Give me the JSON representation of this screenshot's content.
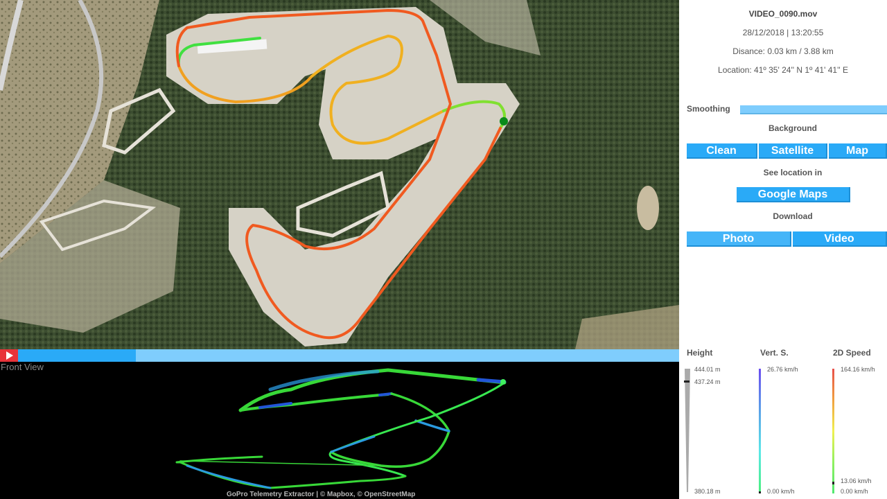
{
  "video": {
    "filename": "VIDEO_0090.mov",
    "datetime": "28/12/2018 | 13:20:55",
    "distance": "Disance: 0.03 km / 3.88 km",
    "location": "Location: 41º 35' 24'' N 1º 41' 41'' E"
  },
  "controls": {
    "smoothing_label": "Smoothing",
    "background_label": "Background",
    "background_options": [
      "Clean",
      "Satellite",
      "Map"
    ],
    "see_location_label": "See location in",
    "google_maps_button": "Google Maps",
    "download_label": "Download",
    "download_options": [
      "Photo",
      "Video"
    ]
  },
  "timeline": {
    "progress": 0.2,
    "play_icon": "play-icon"
  },
  "front_view": {
    "label": "Front View",
    "credits": "GoPro Telemetry Extractor | © Mapbox, © OpenStreetMap"
  },
  "gauges": {
    "height": {
      "title": "Height",
      "max": "444.01 m",
      "current": "437.24 m",
      "min": "380.18 m",
      "current_fraction": 0.9,
      "color": "#aaaaaa"
    },
    "vert_speed": {
      "title": "Vert. S.",
      "max": "26.76 km/h",
      "min": "0.00 km/h",
      "current_fraction": 0.0,
      "colors": [
        "#6a4cf0",
        "#5aa0e8",
        "#5ae8e8",
        "#4af07a"
      ]
    },
    "speed_2d": {
      "title": "2D Speed",
      "max": "164.16 km/h",
      "current": "13.06 km/h",
      "min": "0.00 km/h",
      "current_fraction": 0.08,
      "colors": [
        "#e8504a",
        "#f0a040",
        "#f0f050",
        "#90f060",
        "#50e870"
      ]
    },
    "marker_color": "#222222"
  },
  "map": {
    "background": "satellite",
    "current_position_color": "#0a8a1a",
    "track_gradient": [
      "#40e040",
      "#c8f020",
      "#f0e020",
      "#f0a020",
      "#f05020"
    ]
  }
}
